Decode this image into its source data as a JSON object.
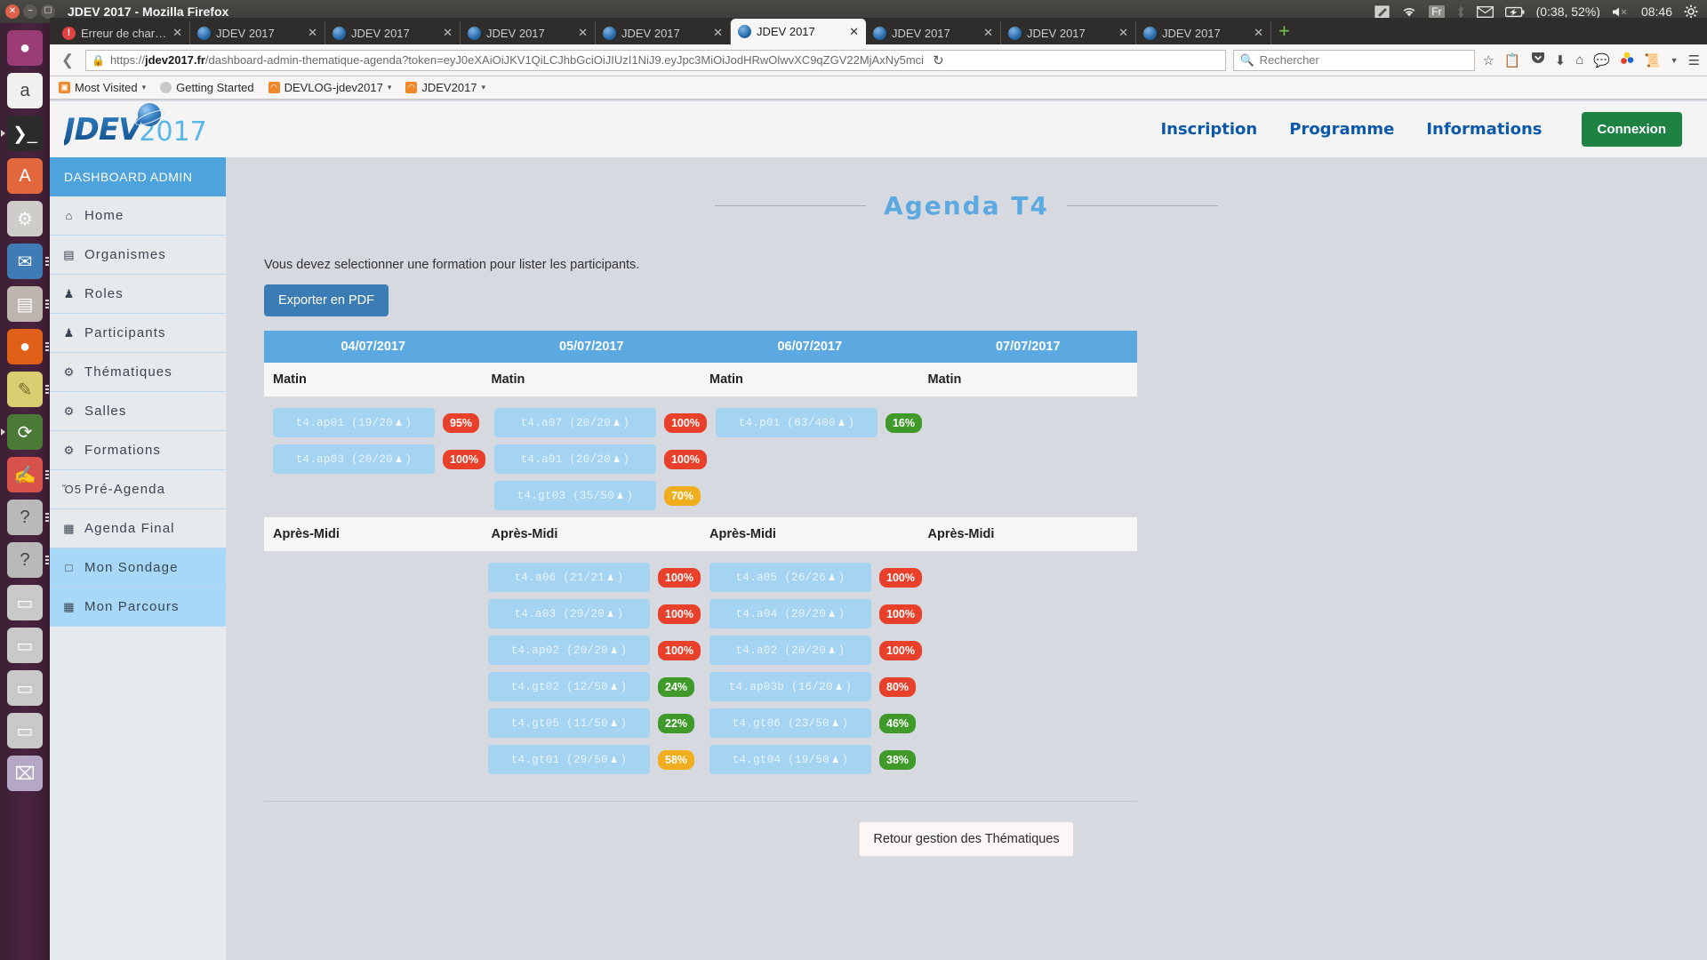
{
  "desktop": {
    "panel": {
      "window_title": "JDEV 2017 - Mozilla Firefox",
      "tray": {
        "keyboard": "Fr",
        "battery": "(0:38, 52%)",
        "clock": "08:46",
        "icons": [
          "note-icon",
          "wifi-icon",
          "keyboard-layout-icon",
          "bluetooth-icon",
          "mail-icon",
          "battery-icon",
          "volume-muted-icon",
          "gear-icon"
        ]
      }
    },
    "launcher": [
      {
        "name": "ubuntu-dash-icon",
        "glyph": "●",
        "bg": "#9a3d75"
      },
      {
        "name": "amazon-icon",
        "glyph": "a",
        "bg": "#f0f0ee"
      },
      {
        "name": "terminal-icon",
        "glyph": "❯_",
        "bg": "#2b2b2b"
      },
      {
        "name": "software-center-icon",
        "glyph": "A",
        "bg": "#e2673c"
      },
      {
        "name": "system-settings-icon",
        "glyph": "⚙",
        "bg": "#cfcdc9"
      },
      {
        "name": "thunderbird-icon",
        "glyph": "✉",
        "bg": "#3f7cb5"
      },
      {
        "name": "files-icon",
        "glyph": "▤",
        "bg": "#bdb5ae"
      },
      {
        "name": "firefox-icon",
        "glyph": "●",
        "bg": "#e06018"
      },
      {
        "name": "text-editor-icon",
        "glyph": "✎",
        "bg": "#d9cf72"
      },
      {
        "name": "software-updater-icon",
        "glyph": "⟳",
        "bg": "#4a7a36"
      },
      {
        "name": "pdf-reader-icon",
        "glyph": "✍",
        "bg": "#d6524a"
      },
      {
        "name": "unknown-app-icon",
        "glyph": "?",
        "bg": "#b9b9b9"
      },
      {
        "name": "unknown-app-2-icon",
        "glyph": "?",
        "bg": "#b9b9b9"
      },
      {
        "name": "drive-icon",
        "glyph": "▭",
        "bg": "#c9c9c9"
      },
      {
        "name": "drive-2-icon",
        "glyph": "▭",
        "bg": "#c9c9c9"
      },
      {
        "name": "drive-3-icon",
        "glyph": "▭",
        "bg": "#c9c9c9"
      },
      {
        "name": "drive-4-icon",
        "glyph": "▭",
        "bg": "#c9c9c9"
      },
      {
        "name": "trash-icon",
        "glyph": "⌧",
        "bg": "#b5a8c4"
      }
    ]
  },
  "browser": {
    "tabs": [
      {
        "title": "Erreur de chargem...",
        "active": false,
        "favicon": "error-icon"
      },
      {
        "title": "JDEV 2017",
        "active": false,
        "favicon": "jdev-icon"
      },
      {
        "title": "JDEV 2017",
        "active": false,
        "favicon": "jdev-icon"
      },
      {
        "title": "JDEV 2017",
        "active": false,
        "favicon": "jdev-icon"
      },
      {
        "title": "JDEV 2017",
        "active": false,
        "favicon": "jdev-icon"
      },
      {
        "title": "JDEV 2017",
        "active": true,
        "favicon": "jdev-icon"
      },
      {
        "title": "JDEV 2017",
        "active": false,
        "favicon": "jdev-icon"
      },
      {
        "title": "JDEV 2017",
        "active": false,
        "favicon": "jdev-icon"
      },
      {
        "title": "JDEV 2017",
        "active": false,
        "favicon": "jdev-icon"
      }
    ],
    "tab_close_label": "✕",
    "new_tab_label": "+",
    "url": {
      "scheme": "https://",
      "domain": "jdev2017.fr",
      "path": "/dashboard-admin-thematique-agenda?token=eyJ0eXAiOiJKV1QiLCJhbGciOiJIUzI1NiJ9.eyJpc3MiOiJodHRwOlwvXC9qZGV22MjAxNy5mci"
    },
    "search_placeholder": "Rechercher",
    "toolbar_icons": [
      "back-icon",
      "forward-icon",
      "reload-icon",
      "bookmark-star-icon",
      "reader-icon",
      "pocket-icon",
      "downloads-icon",
      "home-icon",
      "chat-icon",
      "colorpicker-icon",
      "clipboard-icon",
      "overflow-chevron-icon",
      "hamburger-menu-icon"
    ],
    "bookmarks": [
      {
        "label": "Most Visited",
        "icon": "folder-icon",
        "caret": true
      },
      {
        "label": "Getting Started",
        "icon": "globe-icon",
        "caret": false
      },
      {
        "label": "DEVLOG-jdev2017",
        "icon": "rss-icon",
        "caret": true
      },
      {
        "label": "JDEV2017",
        "icon": "rss-icon",
        "caret": true
      }
    ]
  },
  "site": {
    "logo": {
      "main": "JDEV",
      "year": "2017"
    },
    "nav": [
      "Inscription",
      "Programme",
      "Informations"
    ],
    "login_button": "Connexion",
    "accent_blue": "#5ba9e0",
    "login_green": "#1e8245"
  },
  "sidebar": {
    "title": "DASHBOARD ADMIN",
    "items": [
      {
        "label": "Home",
        "icon": "home-icon",
        "glyph": "⌂",
        "active": false
      },
      {
        "label": "Organismes",
        "icon": "document-icon",
        "glyph": "▤",
        "active": false
      },
      {
        "label": "Roles",
        "icon": "users-icon",
        "glyph": "♟",
        "active": false
      },
      {
        "label": "Participants",
        "icon": "user-icon",
        "glyph": "♟",
        "active": false
      },
      {
        "label": "Thématiques",
        "icon": "gears-icon",
        "glyph": "⚙",
        "active": false
      },
      {
        "label": "Salles",
        "icon": "gears-icon",
        "glyph": "⚙",
        "active": false
      },
      {
        "label": "Formations",
        "icon": "gears-icon",
        "glyph": "⚙",
        "active": false
      },
      {
        "label": "Pré-Agenda",
        "icon": "calendar-icon",
        "glyph": "Ὄ5",
        "active": false
      },
      {
        "label": "Agenda Final",
        "icon": "calendar-grid-icon",
        "glyph": "▦",
        "active": false
      },
      {
        "label": "Mon Sondage",
        "icon": "calendar-icon",
        "glyph": "□",
        "active": true
      },
      {
        "label": "Mon Parcours",
        "icon": "calendar-grid-icon",
        "glyph": "▦",
        "active": true
      }
    ]
  },
  "main": {
    "page_title": "Agenda T4",
    "notice": "Vous devez selectionner une formation pour lister les participants.",
    "export_button": "Exporter en PDF",
    "back_button": "Retour gestion des Thématiques",
    "agenda": {
      "dates": [
        "04/07/2017",
        "05/07/2017",
        "06/07/2017",
        "07/07/2017"
      ],
      "slots": [
        {
          "label": "Matin",
          "columns": [
            [
              {
                "code": "t4.ap01",
                "count": "(19/20",
                "pct": "95%",
                "color": "#e8402a"
              },
              {
                "code": "t4.ap03",
                "count": "(20/20",
                "pct": "100%",
                "color": "#e8402a"
              }
            ],
            [
              {
                "code": "t4.a07",
                "count": "(20/20",
                "pct": "100%",
                "color": "#e8402a"
              },
              {
                "code": "t4.a01",
                "count": "(20/20",
                "pct": "100%",
                "color": "#e8402a"
              },
              {
                "code": "t4.gt03",
                "count": "(35/50",
                "pct": "70%",
                "color": "#f0ad1e"
              }
            ],
            [
              {
                "code": "t4.p01",
                "count": "(63/400",
                "pct": "16%",
                "color": "#3f9a29"
              }
            ],
            []
          ]
        },
        {
          "label": "Après-Midi",
          "columns": [
            [],
            [
              {
                "code": "t4.a06",
                "count": "(21/21",
                "pct": "100%",
                "color": "#e8402a"
              },
              {
                "code": "t4.a03",
                "count": "(20/20",
                "pct": "100%",
                "color": "#e8402a"
              },
              {
                "code": "t4.ap02",
                "count": "(20/20",
                "pct": "100%",
                "color": "#e8402a"
              },
              {
                "code": "t4.gt02",
                "count": "(12/50",
                "pct": "24%",
                "color": "#3f9a29"
              },
              {
                "code": "t4.gt05",
                "count": "(11/50",
                "pct": "22%",
                "color": "#3f9a29"
              },
              {
                "code": "t4.gt01",
                "count": "(29/50",
                "pct": "58%",
                "color": "#f0ad1e"
              }
            ],
            [
              {
                "code": "t4.a05",
                "count": "(26/26",
                "pct": "100%",
                "color": "#e8402a"
              },
              {
                "code": "t4.a04",
                "count": "(20/20",
                "pct": "100%",
                "color": "#e8402a"
              },
              {
                "code": "t4.a02",
                "count": "(20/20",
                "pct": "100%",
                "color": "#e8402a"
              },
              {
                "code": "t4.ap03b",
                "count": "(16/20",
                "pct": "80%",
                "color": "#e8402a"
              },
              {
                "code": "t4.gt06",
                "count": "(23/50",
                "pct": "46%",
                "color": "#3f9a29"
              },
              {
                "code": "t4.gt04",
                "count": "(19/50",
                "pct": "38%",
                "color": "#3f9a29"
              }
            ],
            []
          ]
        }
      ]
    }
  }
}
